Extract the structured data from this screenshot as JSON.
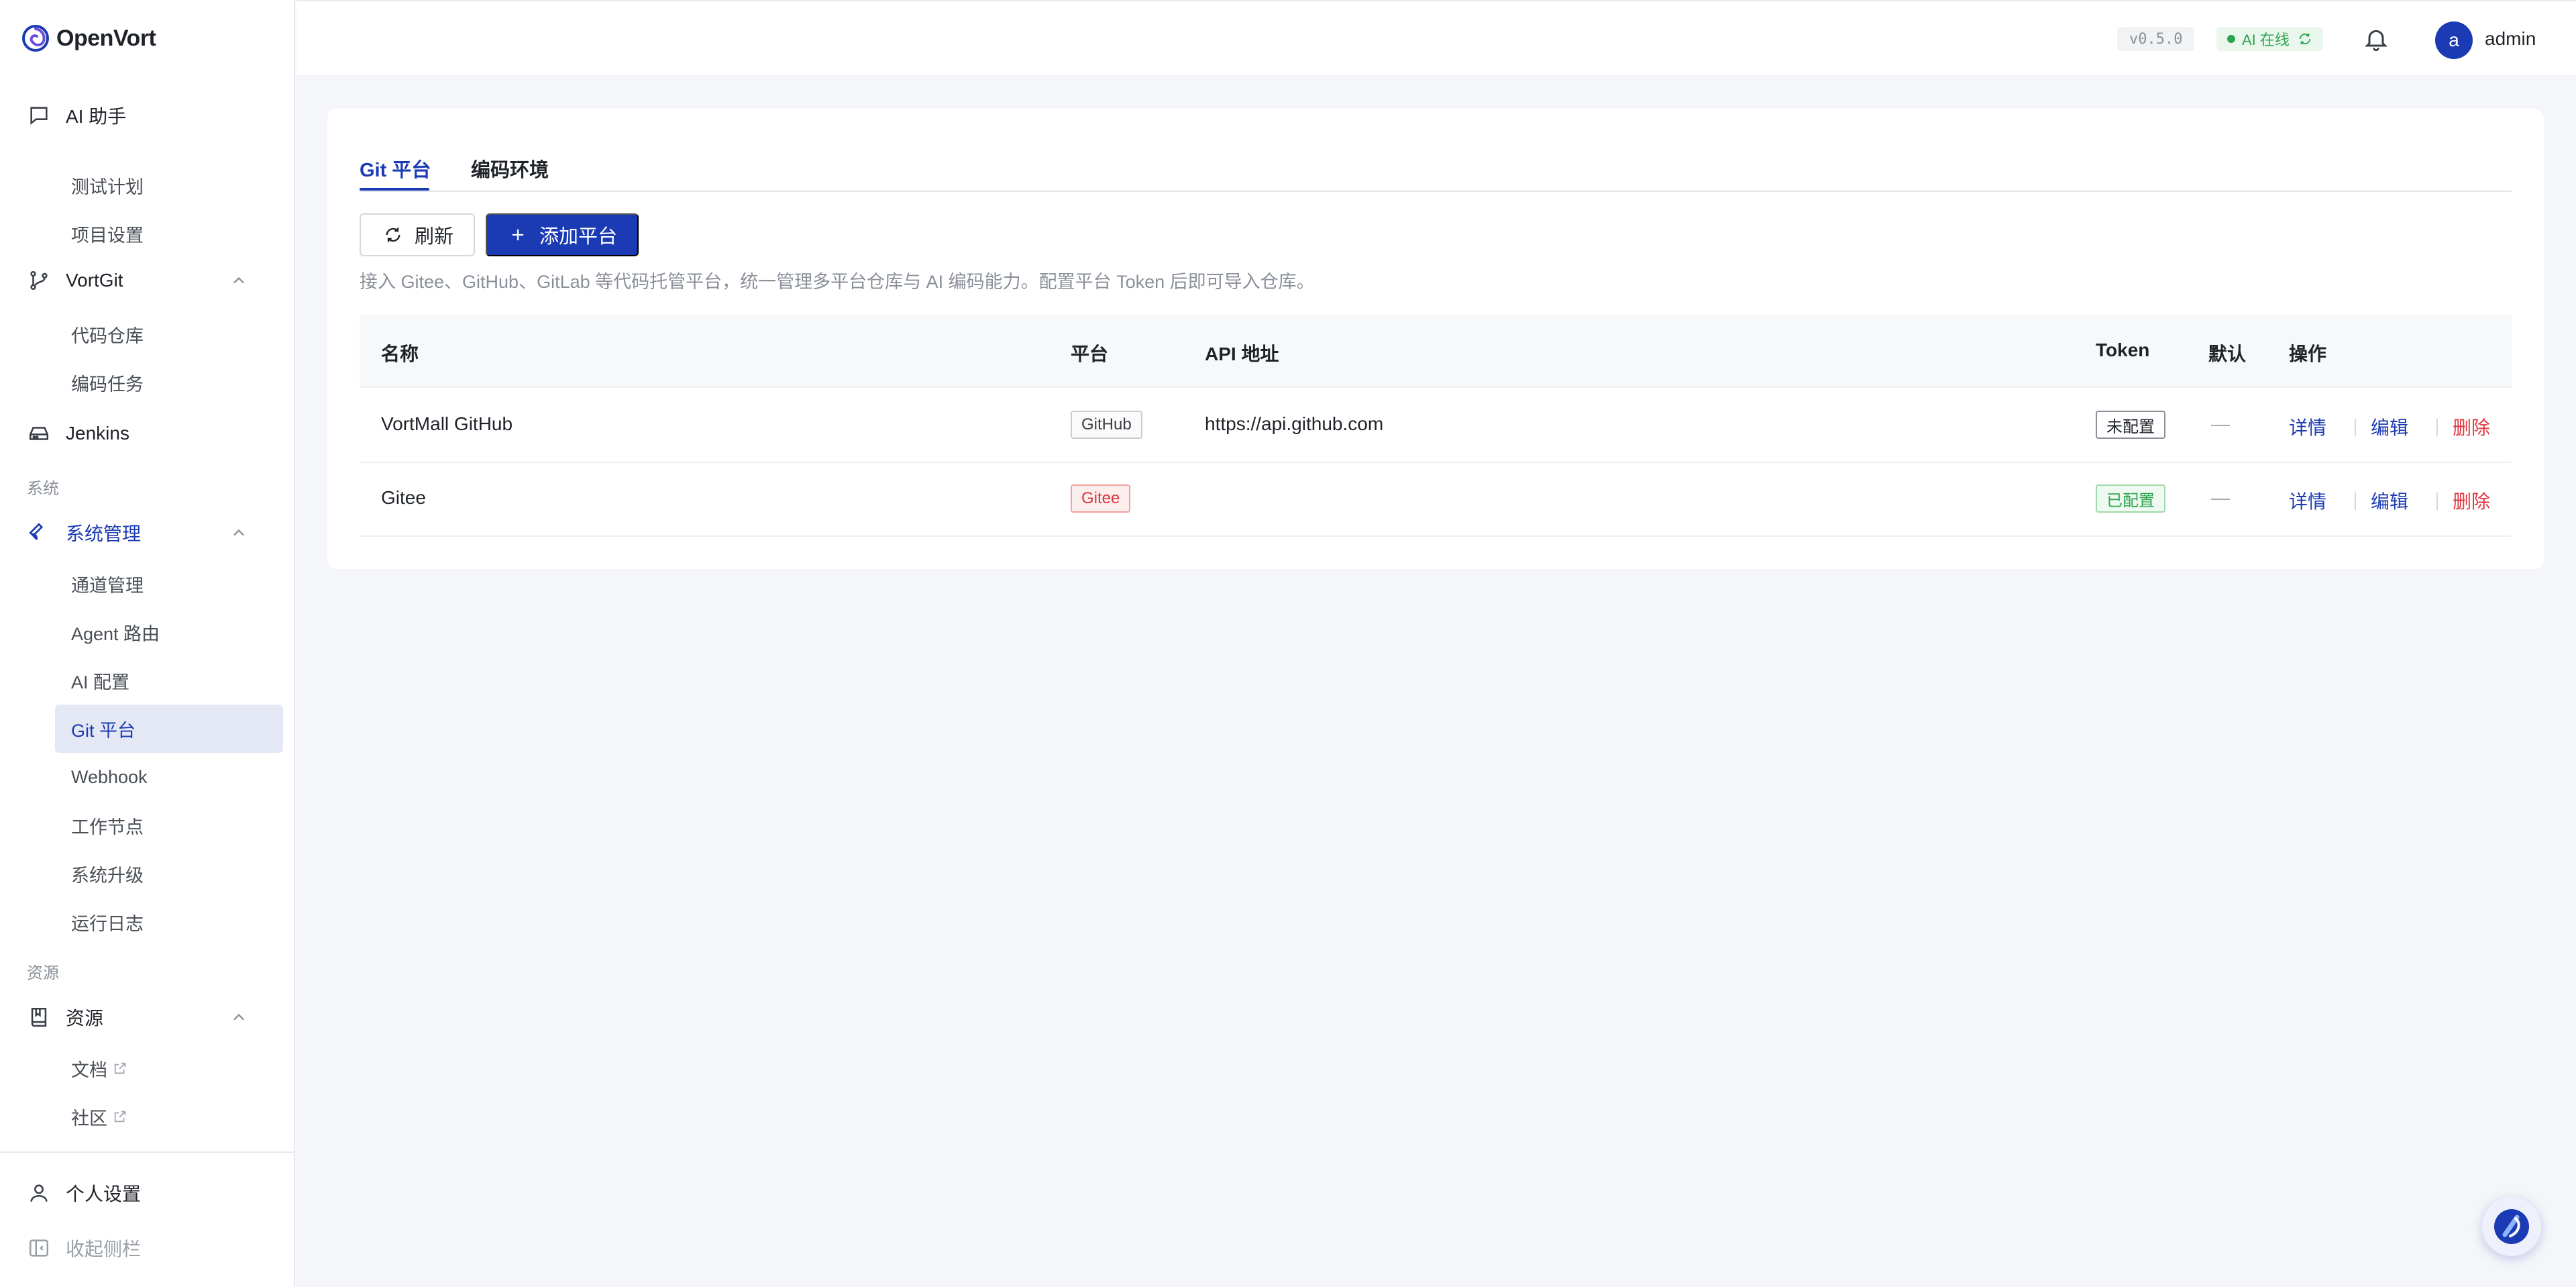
{
  "app": {
    "name": "OpenVort",
    "version": "v0.5.0",
    "ai_status": "AI 在线",
    "user_initial": "a",
    "username": "admin"
  },
  "colors": {
    "primary": "#1a3bb3",
    "success": "#2ea44f",
    "danger": "#e0363f"
  },
  "sidebar": {
    "ai_assistant": "AI 助手",
    "items": [
      {
        "label": "测试计划"
      },
      {
        "label": "项目设置"
      },
      {
        "label": "VortGit"
      },
      {
        "label": "代码仓库"
      },
      {
        "label": "编码任务"
      },
      {
        "label": "Jenkins"
      },
      {
        "label": "系统"
      },
      {
        "label": "系统管理"
      },
      {
        "label": "通道管理"
      },
      {
        "label": "Agent 路由"
      },
      {
        "label": "AI 配置"
      },
      {
        "label": "Git 平台"
      },
      {
        "label": "Webhook"
      },
      {
        "label": "工作节点"
      },
      {
        "label": "系统升级"
      },
      {
        "label": "运行日志"
      },
      {
        "label": "资源"
      },
      {
        "label": "资源"
      },
      {
        "label": "文档"
      },
      {
        "label": "社区"
      }
    ],
    "personal_settings": "个人设置",
    "collapse": "收起侧栏"
  },
  "tabs": [
    {
      "label": "Git 平台"
    },
    {
      "label": "编码环境"
    }
  ],
  "toolbar": {
    "refresh_label": "刷新",
    "add_label": "添加平台",
    "description": "接入 Gitee、GitHub、GitLab 等代码托管平台，统一管理多平台仓库与 AI 编码能力。配置平台 Token 后即可导入仓库。"
  },
  "table": {
    "columns": [
      "名称",
      "平台",
      "API 地址",
      "Token",
      "默认",
      "操作"
    ],
    "rows": [
      {
        "name": "VortMall GitHub",
        "platform": "GitHub",
        "api": "https://api.github.com",
        "token": "未配置",
        "default": "—"
      },
      {
        "name": "Gitee",
        "platform": "Gitee",
        "api": "",
        "token": "已配置",
        "default": "—"
      }
    ],
    "actions": {
      "detail": "详情",
      "edit": "编辑",
      "delete": "删除"
    }
  },
  "icons": {
    "logo": "openvort-swirl-icon",
    "chat": "chat-bubble-icon",
    "git": "git-branch-icon",
    "server": "server-icon",
    "wrench": "wrench-icon",
    "book": "book-icon",
    "user": "user-icon",
    "collapse": "sidebar-collapse-icon",
    "bell": "bell-icon",
    "refresh": "refresh-icon",
    "plus": "plus-icon",
    "external": "external-link-icon"
  }
}
